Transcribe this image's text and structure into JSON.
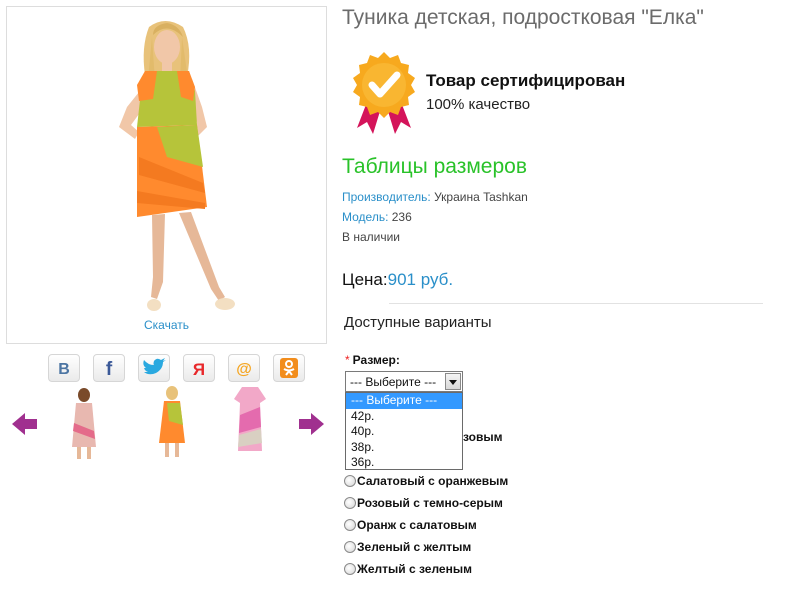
{
  "product": {
    "title": "Туника детская, подростковая \"Елка\"",
    "download_label": "Скачать",
    "certified_title": "Товар сертифицирован",
    "certified_subtitle": "100% качество",
    "sizes_table_link": "Таблицы размеров",
    "manufacturer_label": "Производитель:",
    "manufacturer_value": " Украина Tashkan",
    "model_label": "Модель:",
    "model_value": " 236",
    "availability": "В наличии",
    "price_label": "Цена:",
    "price_value": "901 руб."
  },
  "social": [
    "vk-icon",
    "facebook-icon",
    "twitter-icon",
    "odnoklassniki-icon",
    "mailru-icon",
    "ok-icon"
  ],
  "options": {
    "title": "Доступные варианты",
    "size_label": "Размер:",
    "required_mark": "*",
    "size_selected": "--- Выберите ---",
    "size_options": [
      "--- Выберите ---",
      "42р.",
      "40р.",
      "38р.",
      "36р."
    ],
    "color_partial": "зовым",
    "colors": [
      "Салатовый с оранжевым",
      "Розовый с темно-серым",
      "Оранж с салатовым",
      "Зеленый с желтым",
      "Желтый с зеленым"
    ]
  },
  "colors": {
    "link_blue": "#2a8fc9",
    "sizes_green": "#29c229",
    "highlight": "#3399ff",
    "dress_orange": "#ff8a2e",
    "dress_lime": "#b6c43a",
    "arrow_purple": "#a0308f"
  }
}
